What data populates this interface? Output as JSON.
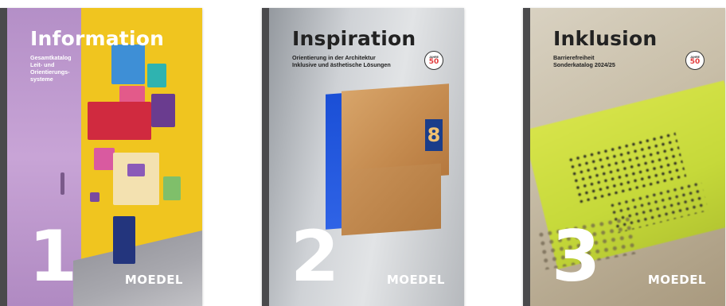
{
  "catalogs": [
    {
      "title": "Information",
      "subtitle_lines": [
        "Gesamtkatalog",
        "Leit- und",
        "Orientierungs-",
        "systeme"
      ],
      "number": "1",
      "logo": "MOEDEL"
    },
    {
      "title": "Inspiration",
      "subtitle_lines": [
        "Orientierung in der Architektur",
        "Inklusive und ästhetische Lösungen"
      ],
      "number": "2",
      "logo": "MOEDEL",
      "badge": {
        "top": "JAHRE",
        "number": "50"
      }
    },
    {
      "title": "Inklusion",
      "subtitle_lines": [
        "Barrierefreiheit",
        "Sonderkatalog 2024/25"
      ],
      "number": "3",
      "logo": "MOEDEL",
      "badge": {
        "top": "JAHRE",
        "number": "50"
      }
    }
  ],
  "colors": {
    "spine": "#4a4a4c",
    "cat1_yellow": "#f0c51f",
    "cat1_lilac": "#c8a4d6",
    "cat2_blue": "#1a4fd6",
    "cat3_yellow": "#d7e44a",
    "logo_accent": "#ff3b3b"
  },
  "icons": [
    "jahre-50-badge-icon",
    "moedel-logo-icon"
  ]
}
